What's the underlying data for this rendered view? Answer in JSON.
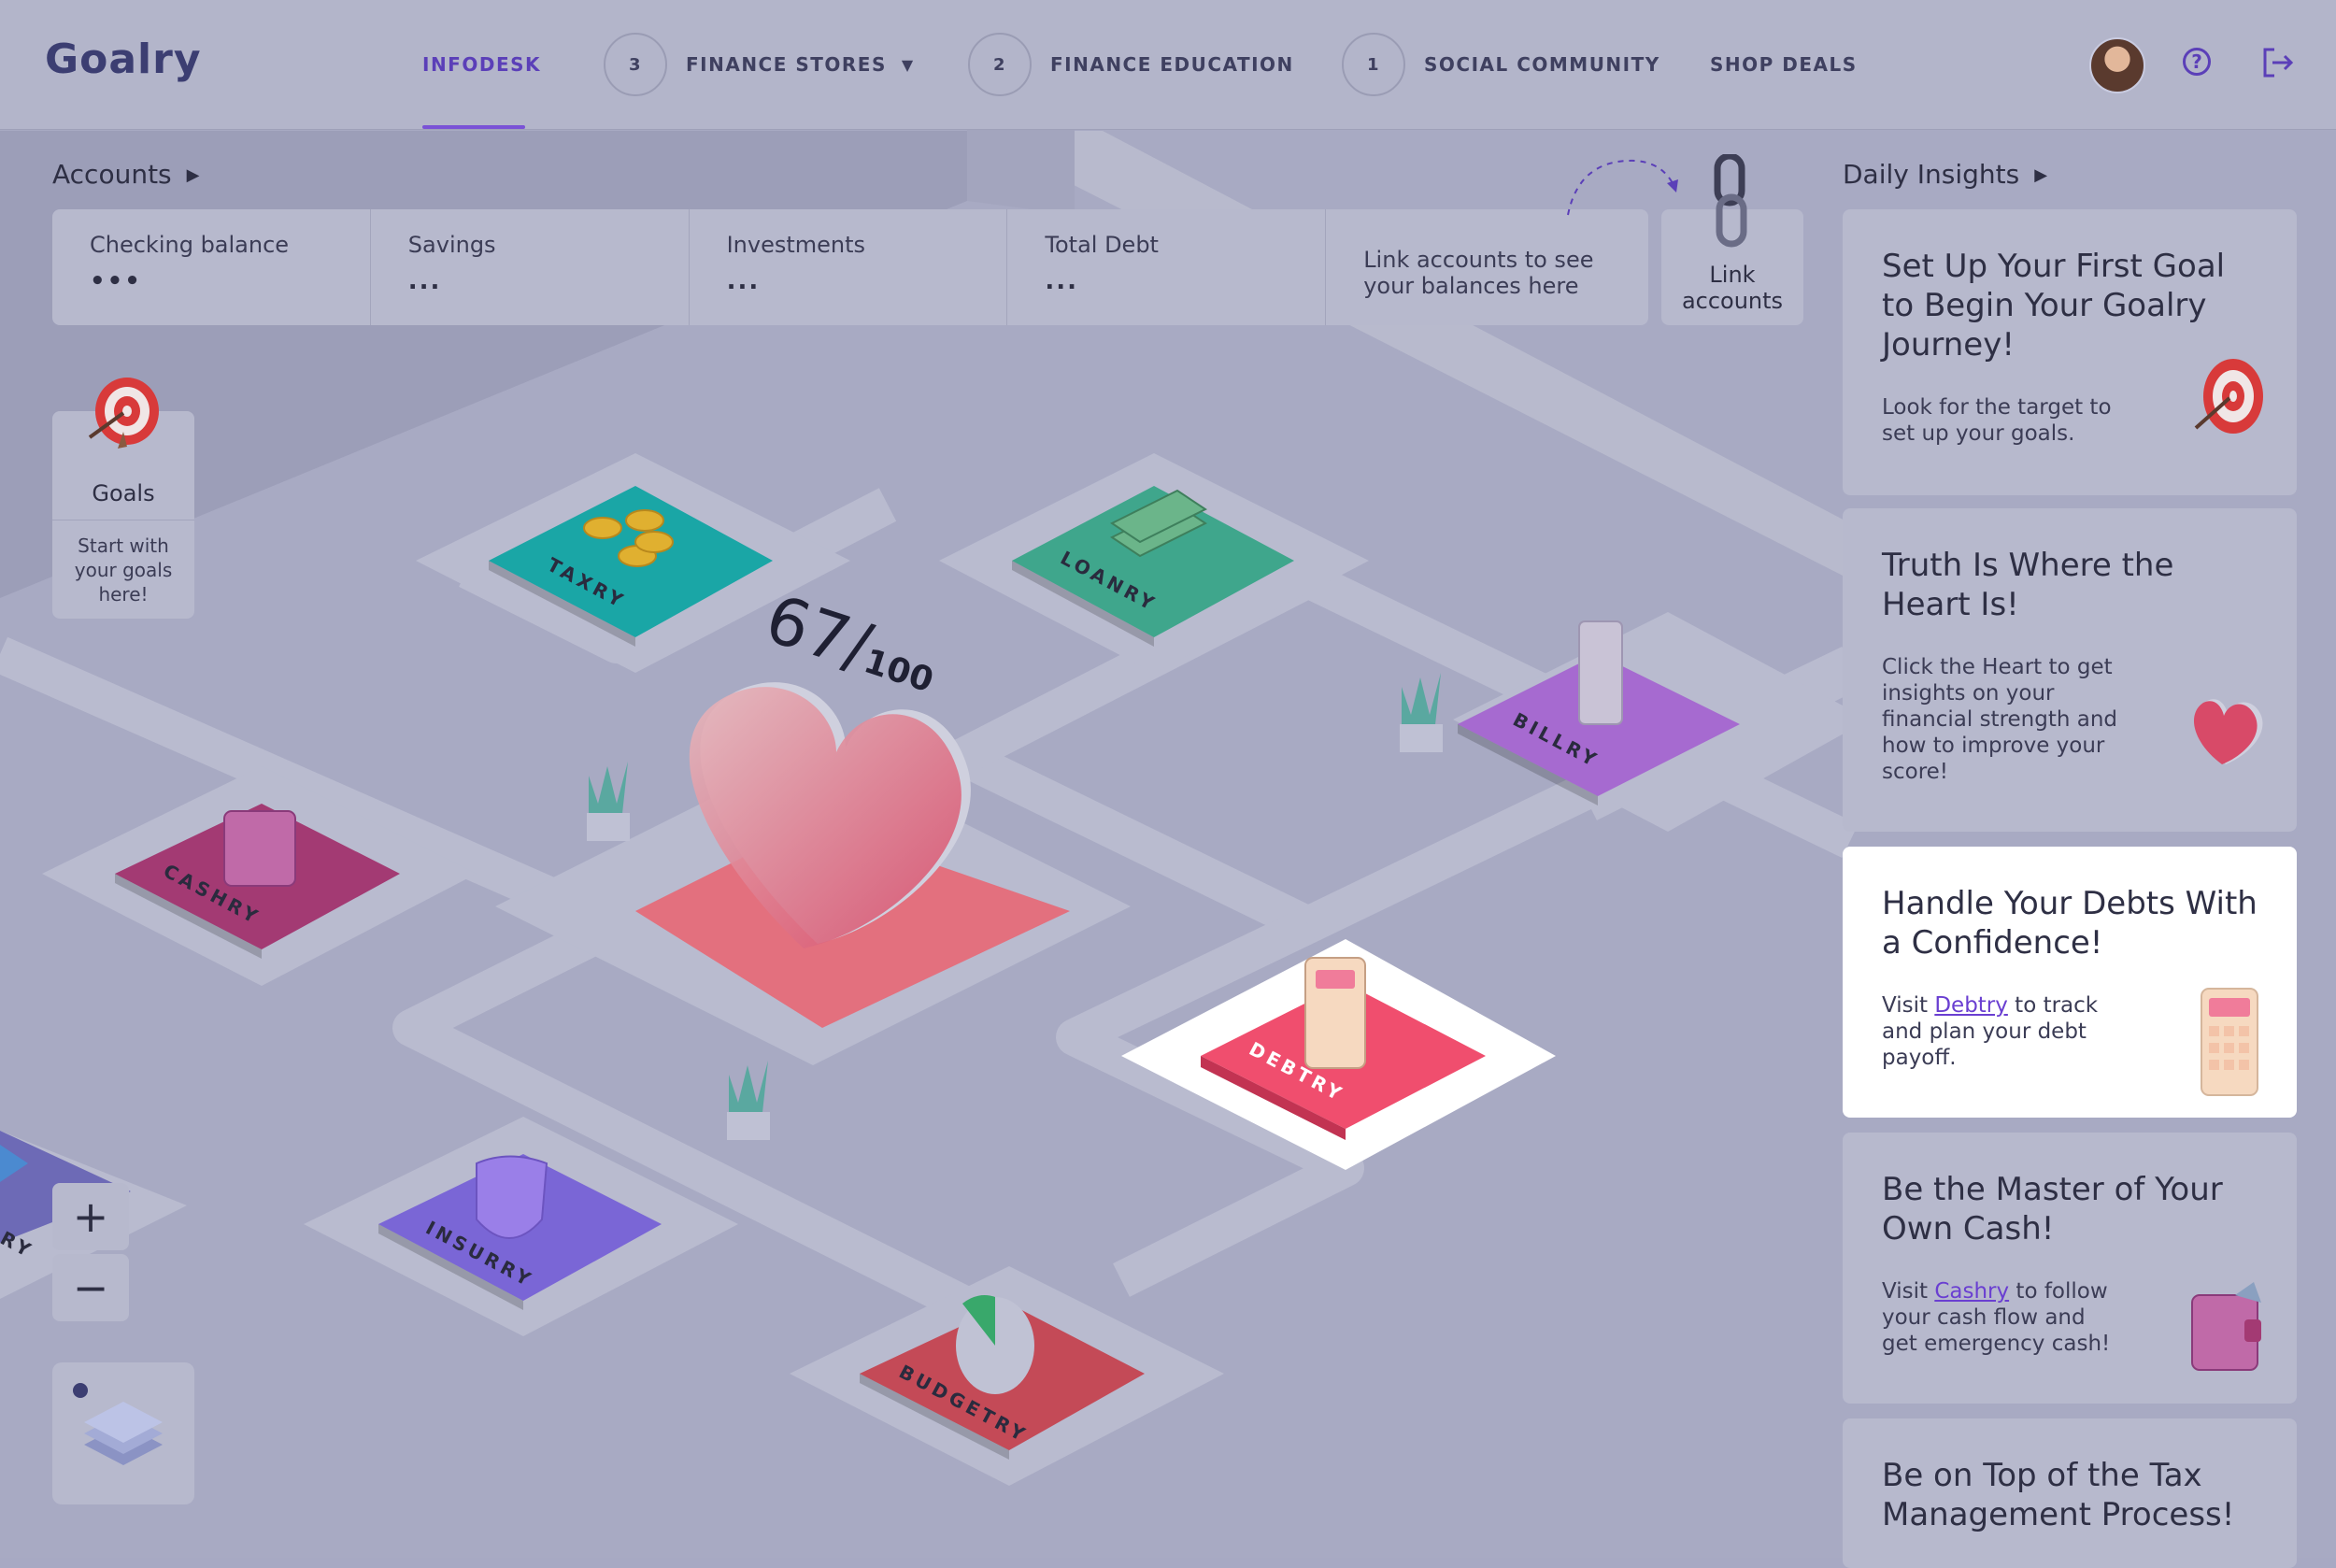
{
  "header": {
    "logo": "Goalry",
    "nav": [
      {
        "label": "INFODESK",
        "count": null,
        "active": true
      },
      {
        "label": "FINANCE STORES",
        "count": "3",
        "dropdown": true
      },
      {
        "label": "FINANCE EDUCATION",
        "count": "2"
      },
      {
        "label": "SOCIAL COMMUNITY",
        "count": "1"
      },
      {
        "label": "SHOP DEALS",
        "count": null
      }
    ],
    "icons": [
      "avatar",
      "help-icon",
      "logout-icon"
    ]
  },
  "accounts": {
    "title": "Accounts",
    "items": [
      {
        "label": "Checking balance",
        "value": "•••"
      },
      {
        "label": "Savings",
        "value": "..."
      },
      {
        "label": "Investments",
        "value": "..."
      },
      {
        "label": "Total Debt",
        "value": "..."
      }
    ],
    "hint": "Link accounts to see your balances here",
    "link_label": "Link accounts"
  },
  "goals": {
    "title": "Goals",
    "desc": "Start with your goals here!"
  },
  "board": {
    "score": "67",
    "score_max": "100",
    "tiles": [
      "TAXRY",
      "LOANRY",
      "BILLRY",
      "CASHRY",
      "DEBTRY",
      "INSURRY",
      "BUDGETRY",
      "RY"
    ]
  },
  "zoom": {
    "in": "+",
    "out": "−"
  },
  "insights": {
    "title": "Daily Insights",
    "cards": [
      {
        "title": "Set Up Your First Goal to Begin Your Goalry Journey!",
        "body": "Look for the target to set up your goals."
      },
      {
        "title": "Truth Is Where the Heart Is!",
        "body": "Click the Heart to get insights on your financial strength and how to improve your score!"
      },
      {
        "title": "Handle Your Debts With a Confidence!",
        "pre": "Visit ",
        "link": "Debtry",
        "post": " to track and plan your debt payoff."
      },
      {
        "title": "Be the Master of Your Own Cash!",
        "pre": "Visit ",
        "link": "Cashry",
        "post": " to follow your cash flow and get emergency cash!"
      },
      {
        "title": "Be on Top of the Tax Management Process!"
      }
    ]
  },
  "colors": {
    "accent": "#6a3fd1",
    "taxry": "#1aa6a6",
    "loanry": "#3fa68c",
    "billry": "#a66ad0",
    "cashry": "#a33a73",
    "debtry": "#f04e6e",
    "insurry": "#7a66d6",
    "budgetry": "#c44a57",
    "heart": "#e3707e"
  }
}
